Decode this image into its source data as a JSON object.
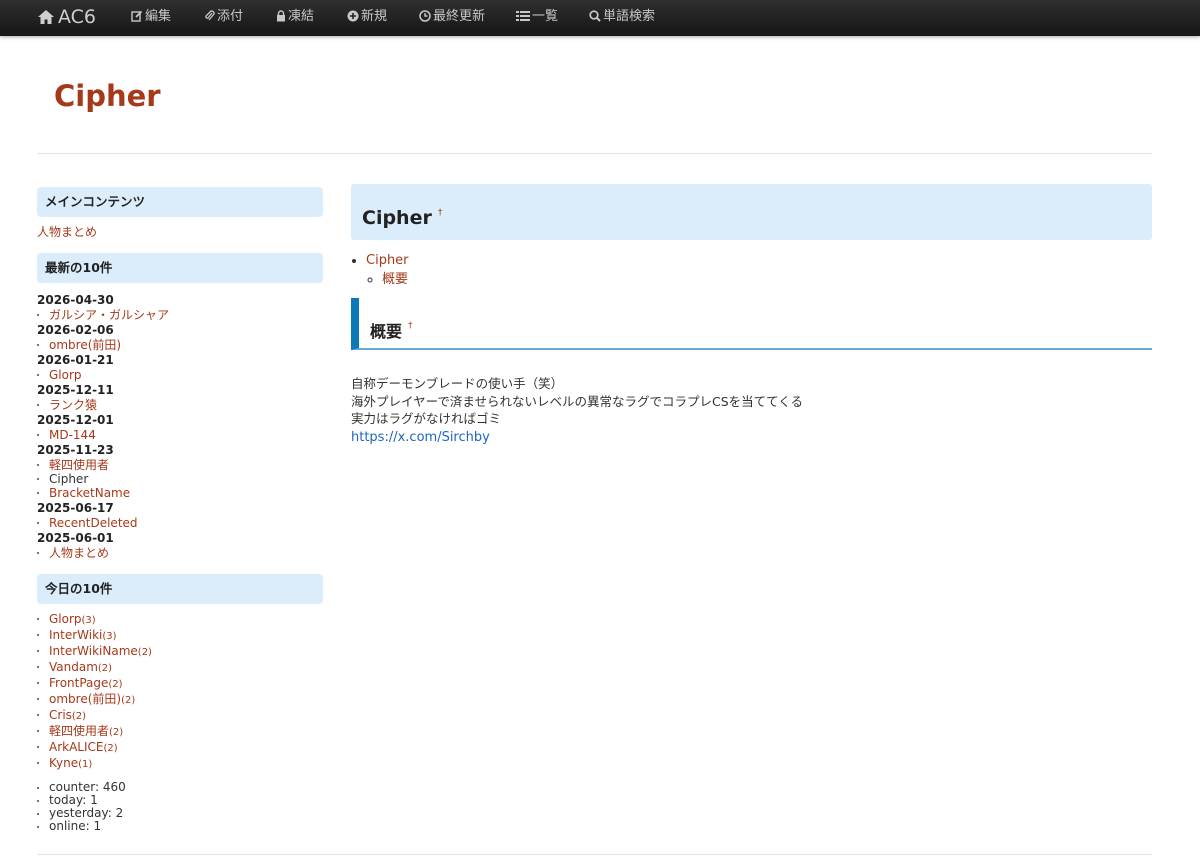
{
  "navbar": {
    "brand": "AC6",
    "items": [
      {
        "id": "edit",
        "label": "編集",
        "icon": "edit-icon"
      },
      {
        "id": "attach",
        "label": "添付",
        "icon": "paperclip-icon"
      },
      {
        "id": "freeze",
        "label": "凍結",
        "icon": "lock-icon"
      },
      {
        "id": "new",
        "label": "新規",
        "icon": "plus-circle-icon"
      },
      {
        "id": "recent",
        "label": "最終更新",
        "icon": "clock-icon"
      },
      {
        "id": "list",
        "label": "一覧",
        "icon": "list-icon"
      },
      {
        "id": "search",
        "label": "単語検索",
        "icon": "search-icon"
      }
    ]
  },
  "site_title": "Cipher",
  "sidebar": {
    "main_heading": "メインコンテンツ",
    "main_link": "人物まとめ",
    "recent_heading": "最新の10件",
    "recent": [
      {
        "date": "2026-04-30",
        "pages": [
          "ガルシア・ガルシャア"
        ]
      },
      {
        "date": "2026-02-06",
        "pages": [
          "ombre(前田)"
        ]
      },
      {
        "date": "2026-01-21",
        "pages": [
          "Glorp"
        ]
      },
      {
        "date": "2025-12-11",
        "pages": [
          "ランク猿"
        ]
      },
      {
        "date": "2025-12-01",
        "pages": [
          "MD-144"
        ]
      },
      {
        "date": "2025-11-23",
        "pages": [
          "軽四使用者",
          "Cipher",
          "BracketName"
        ]
      },
      {
        "date": "2025-06-17",
        "pages": [
          "RecentDeleted"
        ]
      },
      {
        "date": "2025-06-01",
        "pages": [
          "人物まとめ"
        ]
      }
    ],
    "today_heading": "今日の10件",
    "today": [
      {
        "page": "Glorp",
        "count": "(3)"
      },
      {
        "page": "InterWiki",
        "count": "(3)"
      },
      {
        "page": "InterWikiName",
        "count": "(2)"
      },
      {
        "page": "Vandam",
        "count": "(2)"
      },
      {
        "page": "FrontPage",
        "count": "(2)"
      },
      {
        "page": "ombre(前田)",
        "count": "(2)"
      },
      {
        "page": "Cris",
        "count": "(2)"
      },
      {
        "page": "軽四使用者",
        "count": "(2)"
      },
      {
        "page": "ArkALICE",
        "count": "(2)"
      },
      {
        "page": "Kyne",
        "count": "(1)"
      }
    ],
    "counters": [
      "counter: 460",
      "today: 1",
      "yesterday: 2",
      "online: 1"
    ]
  },
  "content": {
    "h1": "Cipher",
    "anchor": "†",
    "toc": {
      "top": "Cipher",
      "sub": "概要"
    },
    "h2": "概要",
    "lines": [
      "自称デーモンブレードの使い手（笑）",
      "海外プレイヤーで済ませられないレベルの異常なラグでコラプレCSを当ててくる",
      "実力はラグがなければゴミ"
    ],
    "link": "https://x.com/Sirchby"
  }
}
